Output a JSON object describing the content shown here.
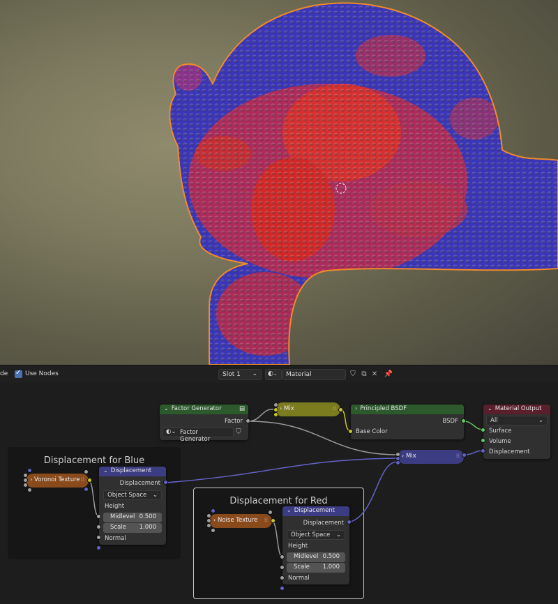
{
  "header": {
    "mode_label_fragment": "de",
    "use_nodes_label": "Use Nodes",
    "slot_label": "Slot 1",
    "material_name": "Material"
  },
  "frames": {
    "blue_title": "Displacement for Blue",
    "red_title": "Displacement for Red"
  },
  "nodes": {
    "factor_generator": {
      "title": "Factor Generator",
      "output_label": "Factor",
      "group_field": "Factor Generator"
    },
    "mix_top": {
      "title": "Mix"
    },
    "principled": {
      "title": "Principled BSDF",
      "output_label": "BSDF",
      "input_label": "Base Color"
    },
    "material_output": {
      "title": "Material Output",
      "target": "All",
      "inputs": [
        "Surface",
        "Volume",
        "Displacement"
      ]
    },
    "mix_displacement": {
      "title": "Mix"
    },
    "voronoi": {
      "title": "Voronoi Texture"
    },
    "noise": {
      "title": "Noise Texture"
    },
    "displacement_blue": {
      "title": "Displacement",
      "output_label": "Displacement",
      "space": "Object Space",
      "height_label": "Height",
      "midlevel_label": "Midlevel",
      "midlevel_value": "0.500",
      "scale_label": "Scale",
      "scale_value": "1.000",
      "normal_label": "Normal"
    },
    "displacement_red": {
      "title": "Displacement",
      "output_label": "Displacement",
      "space": "Object Space",
      "height_label": "Height",
      "midlevel_label": "Midlevel",
      "midlevel_value": "0.500",
      "scale_label": "Scale",
      "scale_value": "1.000",
      "normal_label": "Normal"
    }
  },
  "colors": {
    "texture_header": "#8a4b1c",
    "vector_header": "#3c3c83",
    "shader_header": "#2c5a2c",
    "output_header": "#5a1f2c",
    "color_mix": "#7b7b20",
    "mesh_red": "#d42a2a",
    "mesh_blue": "#3b36b8",
    "selection_outline": "#f08a2c"
  }
}
